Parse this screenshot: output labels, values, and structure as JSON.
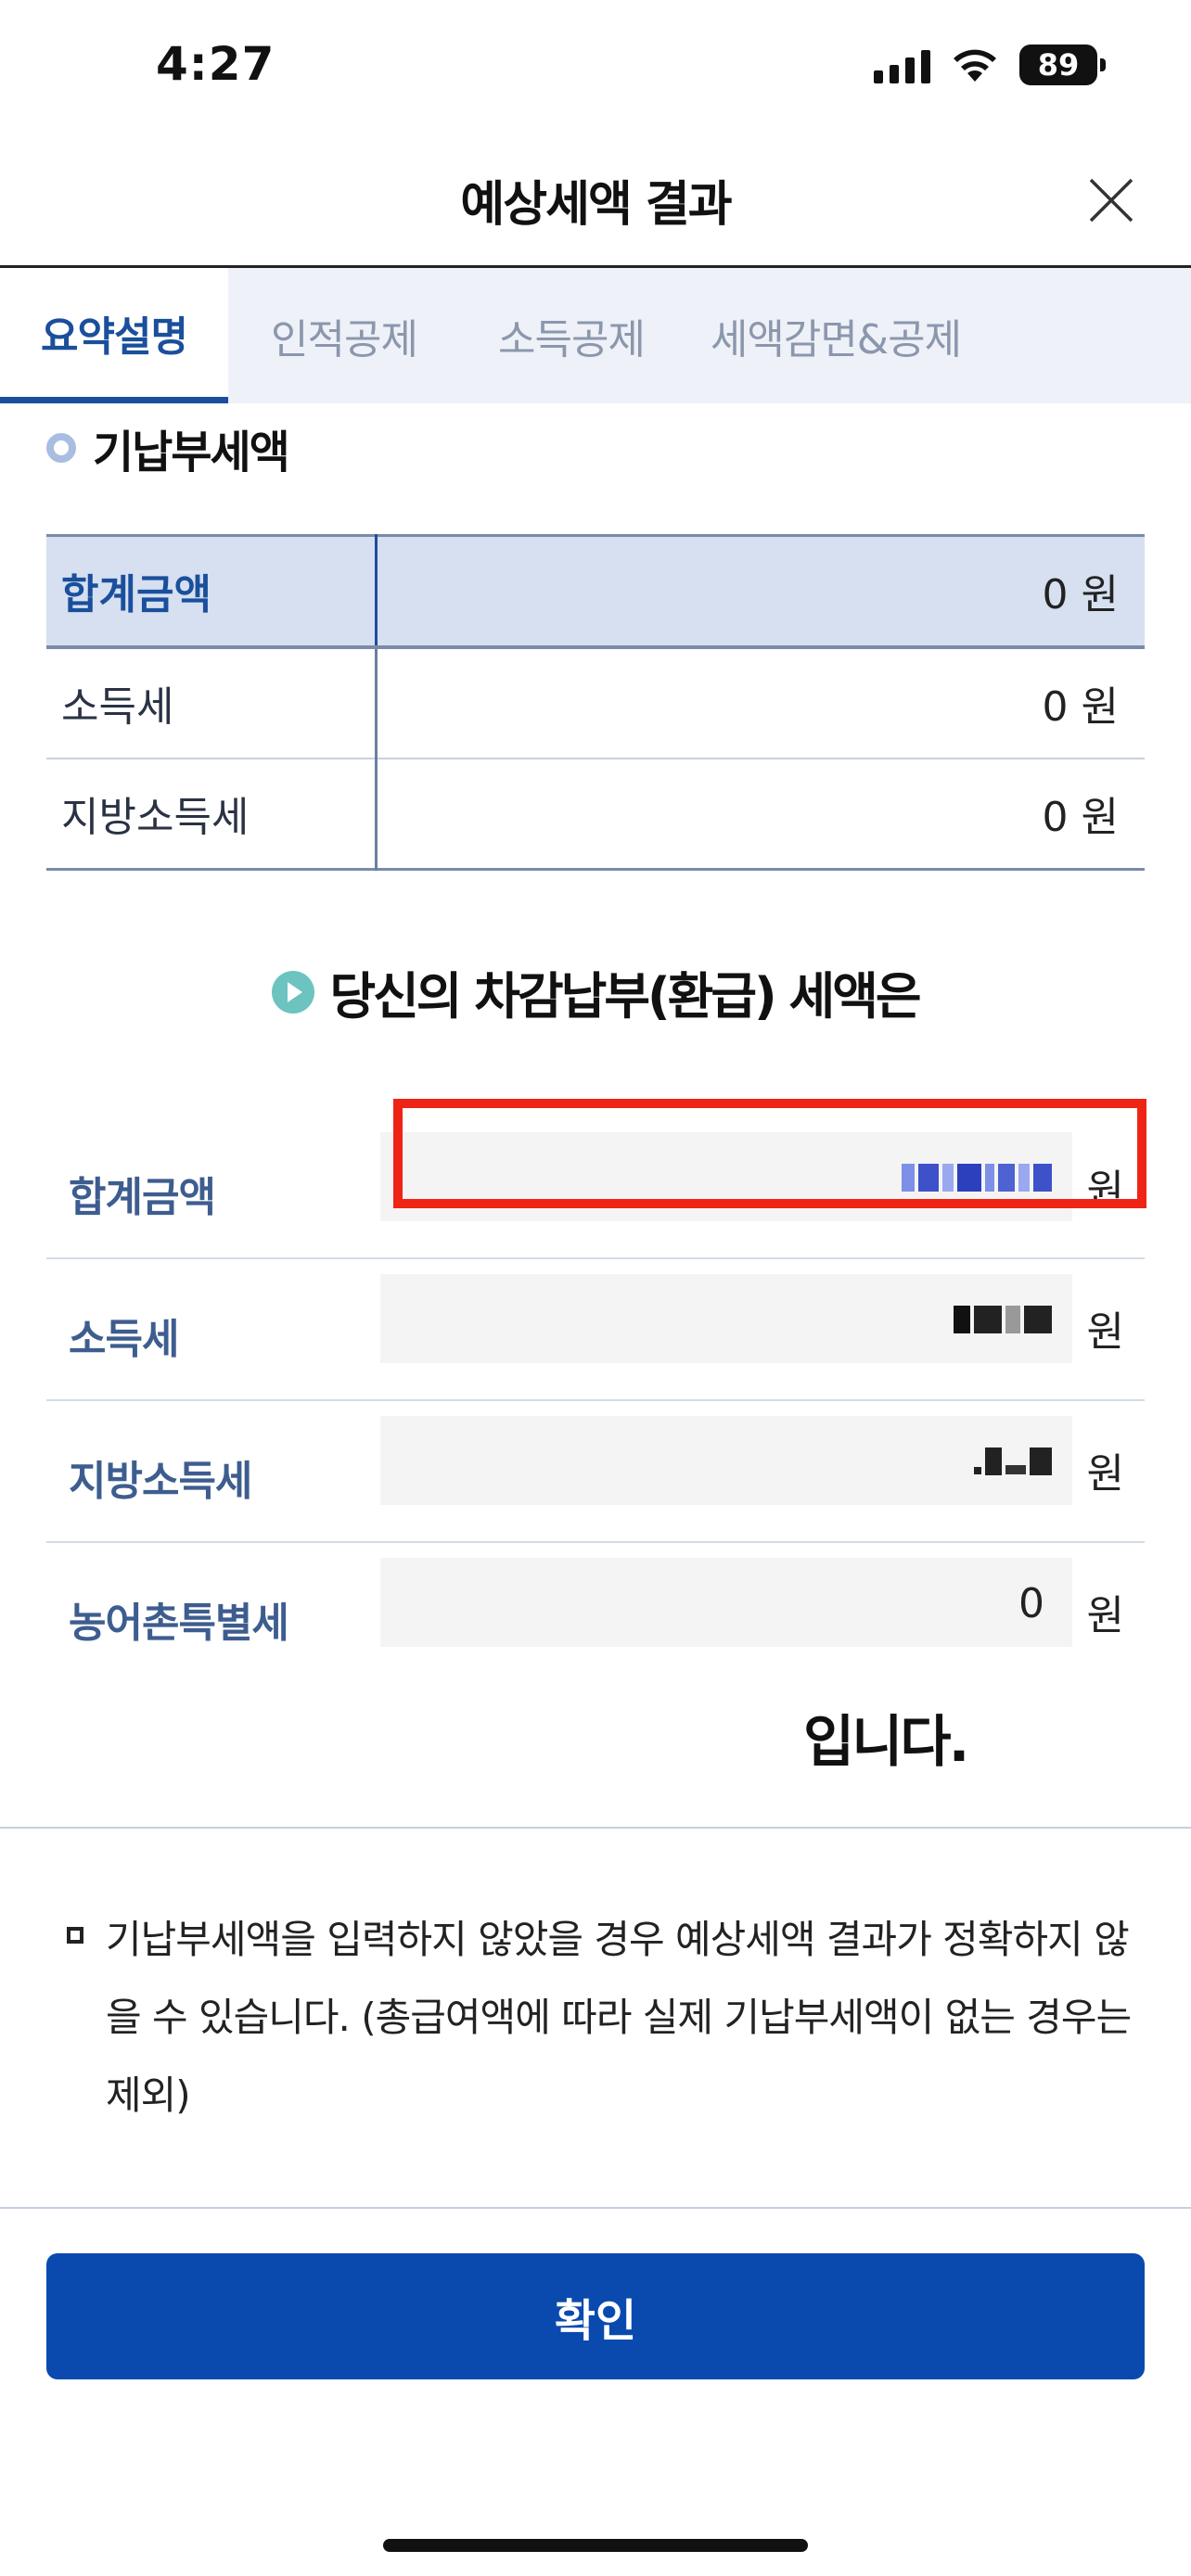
{
  "status_bar": {
    "time": "4:27",
    "battery": "89"
  },
  "header": {
    "title": "예상세액 결과"
  },
  "tabs": [
    {
      "label": "요약설명",
      "active": true
    },
    {
      "label": "인적공제",
      "active": false
    },
    {
      "label": "소득공제",
      "active": false
    },
    {
      "label": "세액감면&공제",
      "active": false
    }
  ],
  "prepaid": {
    "heading": "기납부세액",
    "rows": [
      {
        "label": "합계금액",
        "value": "0 원"
      },
      {
        "label": "소득세",
        "value": "0 원"
      },
      {
        "label": "지방소득세",
        "value": "0 원"
      }
    ]
  },
  "result": {
    "heading": "당신의 차감납부(환급) 세액은",
    "rows": [
      {
        "label": "합계금액",
        "value": "",
        "unit": "원",
        "redacted": true
      },
      {
        "label": "소득세",
        "value": "",
        "unit": "원",
        "redacted": true
      },
      {
        "label": "지방소득세",
        "value": "",
        "unit": "원",
        "redacted": true
      },
      {
        "label": "농어촌특별세",
        "value": "0",
        "unit": "원",
        "redacted": false
      }
    ],
    "suffix": "입니다."
  },
  "note": {
    "text": "기납부세액을 입력하지 않았을 경우 예상세액 결과가 정확하지 않을 수 있습니다. (총급여액에 따라 실제 기납부세액이 없는 경우는 제외)"
  },
  "confirm_button": {
    "label": "확인"
  },
  "colors": {
    "primary": "#0a4aaf",
    "tab_active": "#1a4f9c",
    "highlight": "#ee2415",
    "sum_row_bg": "#d6e0f0",
    "result_label": "#3e5d8f"
  }
}
